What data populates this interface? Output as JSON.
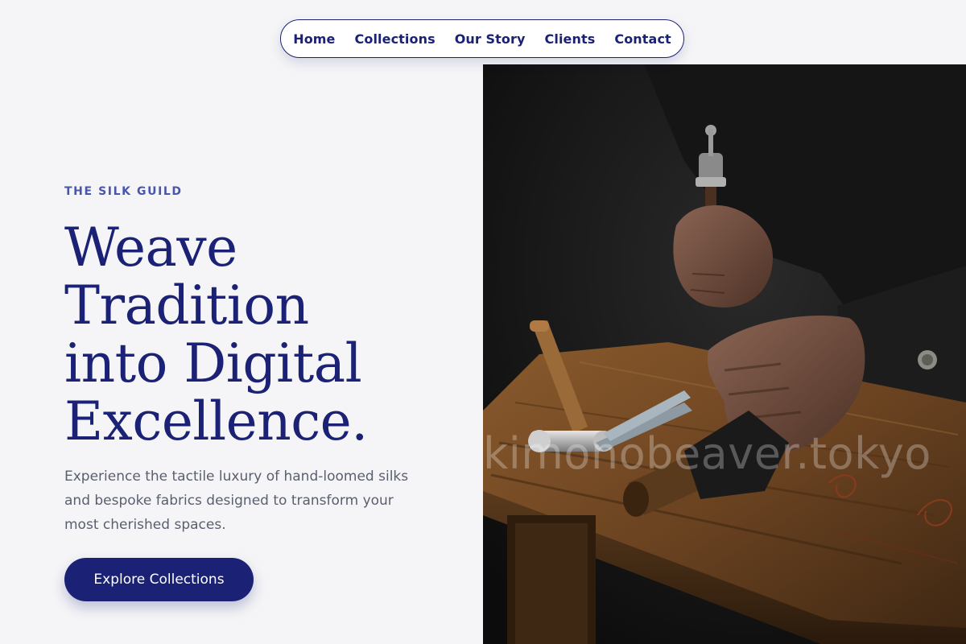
{
  "nav": {
    "items": [
      {
        "label": "Home"
      },
      {
        "label": "Collections"
      },
      {
        "label": "Our Story"
      },
      {
        "label": "Clients"
      },
      {
        "label": "Contact"
      }
    ]
  },
  "hero": {
    "eyebrow": "THE SILK GUILD",
    "headline_lines": [
      "Weave",
      "Tradition",
      "into Digital",
      "Excellence."
    ],
    "subtext": "Experience the tactile luxury of hand-loomed silks and bespoke fabrics designed to transform your most cherished spaces.",
    "cta_label": "Explore Collections",
    "image_watermark": "kimonobeaver.tokyo"
  },
  "colors": {
    "brand": "#1b2275",
    "eyebrow": "#4a55ac",
    "body_text": "#5a5f70",
    "background": "#f5f5f7"
  }
}
